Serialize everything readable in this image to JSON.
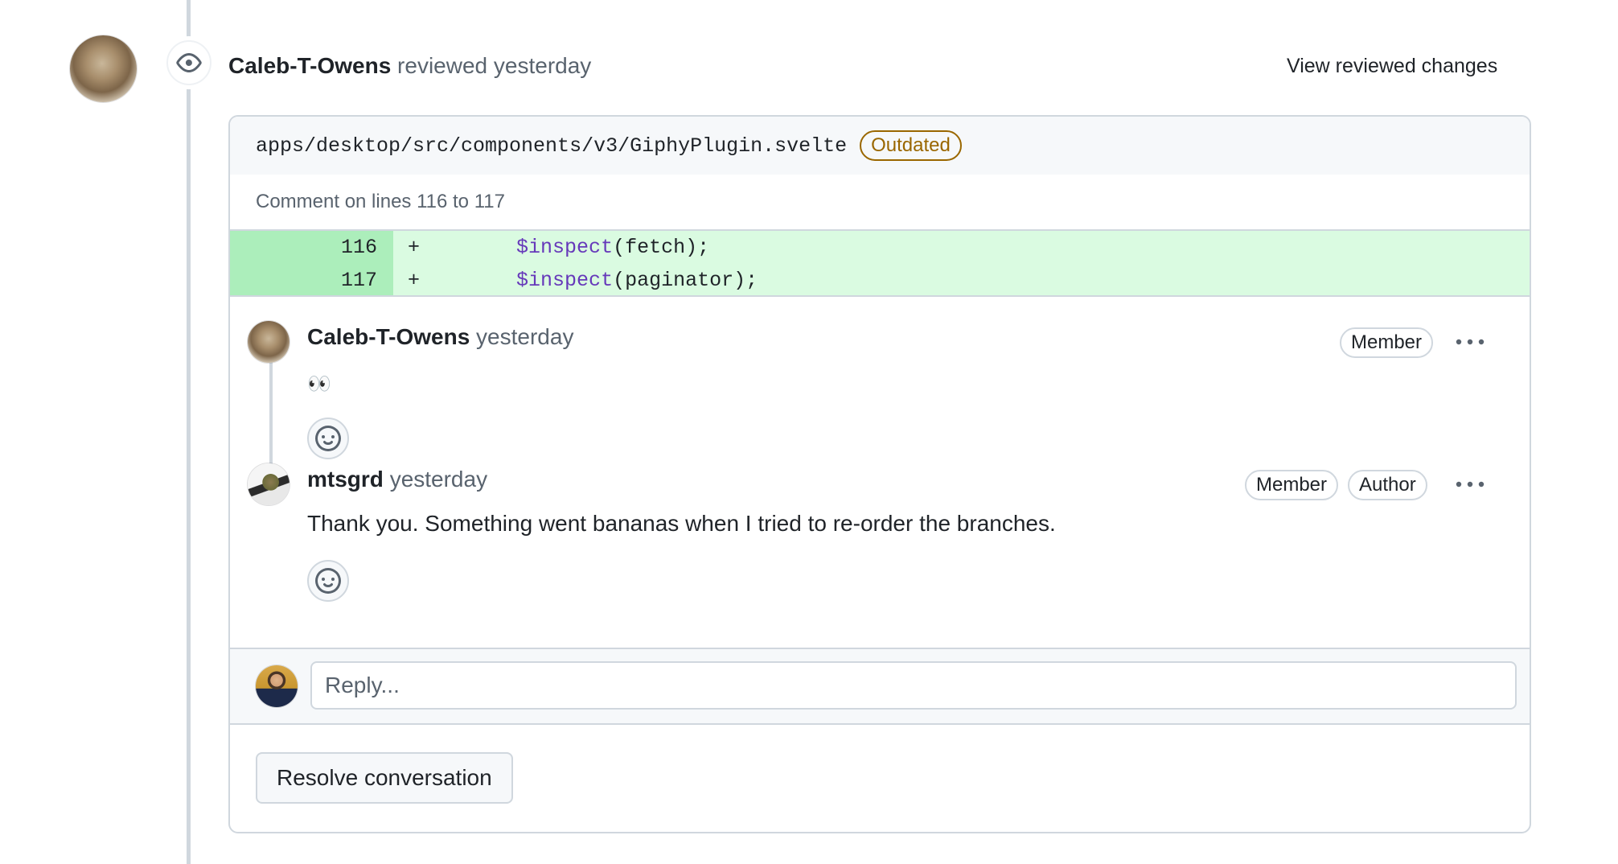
{
  "review": {
    "reviewer": "Caleb-T-Owens",
    "action": "reviewed",
    "time": "yesterday",
    "view_changes_label": "View reviewed changes"
  },
  "file": {
    "path": "apps/desktop/src/components/v3/GiphyPlugin.svelte",
    "status_badge": "Outdated",
    "comment_lines": "Comment on lines 116 to 117"
  },
  "diff": [
    {
      "line": "116",
      "sign": "+",
      "indent": "        ",
      "keyword": "$inspect",
      "rest": "(fetch);"
    },
    {
      "line": "117",
      "sign": "+",
      "indent": "        ",
      "keyword": "$inspect",
      "rest": "(paginator);"
    }
  ],
  "comments": [
    {
      "author": "Caleb-T-Owens",
      "time": "yesterday",
      "badges": [
        "Member"
      ],
      "body": "👀"
    },
    {
      "author": "mtsgrd",
      "time": "yesterday",
      "badges": [
        "Member",
        "Author"
      ],
      "body": "Thank you. Something went bananas when I tried to re-order the branches."
    }
  ],
  "reply": {
    "placeholder": "Reply..."
  },
  "resolve_label": "Resolve conversation",
  "colors": {
    "addition_bg": "#dafbe1",
    "addition_num_bg": "#aceebb",
    "keyword": "#6639ba",
    "outdated": "#9a6700",
    "border": "#d0d7de"
  },
  "icons": {
    "review_badge": "eye-icon",
    "reaction": "smiley-icon",
    "more": "kebab-horizontal-icon"
  }
}
